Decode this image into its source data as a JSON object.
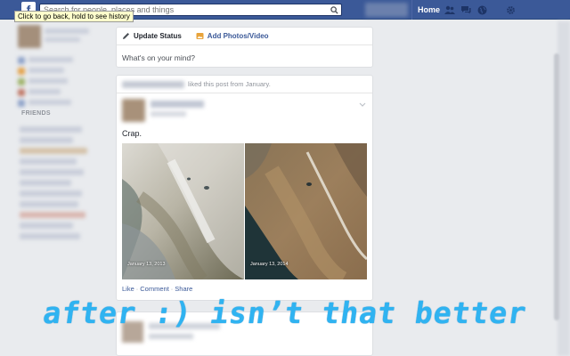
{
  "topbar": {
    "logo": "f",
    "search_placeholder": "Search for people, places and things",
    "tooltip": "Click to go back, hold to see history",
    "home_label": "Home",
    "icons": [
      "friend-requests-icon",
      "messages-icon",
      "notifications-globe-icon",
      "settings-icon"
    ]
  },
  "sidebar": {
    "friends_label": "FRIENDS"
  },
  "composer": {
    "update_status": "Update Status",
    "add_photos": "Add Photos/Video",
    "prompt": "What's on your mind?"
  },
  "story": {
    "activity_text": "liked this post from January.",
    "post_text": "Crap.",
    "photo_left_caption": "January 13, 2013",
    "photo_right_caption": "January 13, 2014",
    "actions": {
      "like": "Like",
      "comment": "Comment",
      "share": "Share",
      "separator": "·"
    }
  },
  "overlay": {
    "caption": "after :) isn’t that better"
  },
  "colors": {
    "brand_blue": "#3b5998",
    "overlay_text": "#2fb3f1",
    "background": "#e9ebee"
  }
}
